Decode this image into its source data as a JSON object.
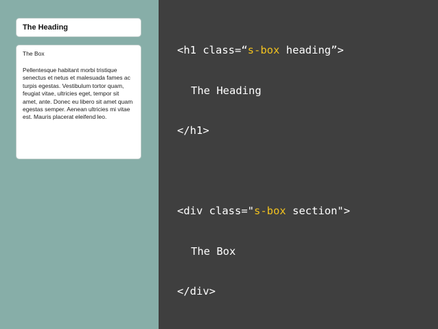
{
  "left_panel": {
    "heading_box": {
      "text": "The Heading"
    },
    "section_box": {
      "title": "The Box",
      "body": "Pellentesque habitant morbi tristique senectus et netus et malesuada fames ac turpis egestas. Vestibulum tortor quam, feugiat vitae, ultricies eget, tempor sit amet, ante. Donec eu libero sit amet quam egestas semper. Aenean ultricies mi vitae est. Mauris placerat eleifend leo."
    }
  },
  "code_panel": {
    "h1_open_prefix": "<h1 class=“",
    "h1_open_class_hl": "s-box",
    "h1_open_suffix": " heading”>",
    "h1_content": "The Heading",
    "h1_close": "</h1>",
    "div_open_prefix": "<div class=\"",
    "div_open_class_hl": "s-box",
    "div_open_suffix": " section\">",
    "div_content": "The Box",
    "div_close": "</div>"
  },
  "colors": {
    "left_background": "#87aea8",
    "code_background": "#3f3f3f",
    "code_text": "#ffffff",
    "code_highlight": "#f2c21f"
  }
}
